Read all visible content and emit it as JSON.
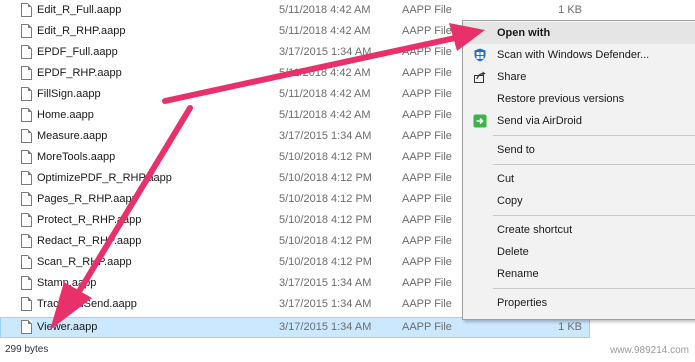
{
  "file_list": {
    "rows": [
      {
        "name": "Edit_R_Full.aapp",
        "date": "5/11/2018 4:42 AM",
        "type": "AAPP File",
        "size": "1 KB"
      },
      {
        "name": "Edit_R_RHP.aapp",
        "date": "5/11/2018 4:42 AM",
        "type": "AAPP File",
        "size": ""
      },
      {
        "name": "EPDF_Full.aapp",
        "date": "3/17/2015 1:34 AM",
        "type": "AAPP File",
        "size": ""
      },
      {
        "name": "EPDF_RHP.aapp",
        "date": "5/11/2018 4:42 AM",
        "type": "AAPP File",
        "size": ""
      },
      {
        "name": "FillSign.aapp",
        "date": "5/11/2018 4:42 AM",
        "type": "AAPP File",
        "size": ""
      },
      {
        "name": "Home.aapp",
        "date": "5/11/2018 4:42 AM",
        "type": "AAPP File",
        "size": ""
      },
      {
        "name": "Measure.aapp",
        "date": "3/17/2015 1:34 AM",
        "type": "AAPP File",
        "size": ""
      },
      {
        "name": "MoreTools.aapp",
        "date": "5/10/2018 4:12 PM",
        "type": "AAPP File",
        "size": ""
      },
      {
        "name": "OptimizePDF_R_RHP.aapp",
        "date": "5/10/2018 4:12 PM",
        "type": "AAPP File",
        "size": ""
      },
      {
        "name": "Pages_R_RHP.aapp",
        "date": "5/10/2018 4:12 PM",
        "type": "AAPP File",
        "size": ""
      },
      {
        "name": "Protect_R_RHP.aapp",
        "date": "5/10/2018 4:12 PM",
        "type": "AAPP File",
        "size": ""
      },
      {
        "name": "Redact_R_RHP.aapp",
        "date": "5/10/2018 4:12 PM",
        "type": "AAPP File",
        "size": ""
      },
      {
        "name": "Scan_R_RHP.aapp",
        "date": "5/10/2018 4:12 PM",
        "type": "AAPP File",
        "size": ""
      },
      {
        "name": "Stamp.aapp",
        "date": "3/17/2015 1:34 AM",
        "type": "AAPP File",
        "size": ""
      },
      {
        "name": "TrackAndSend.aapp",
        "date": "3/17/2015 1:34 AM",
        "type": "AAPP File",
        "size": ""
      },
      {
        "name": "Viewer.aapp",
        "date": "3/17/2015 1:34 AM",
        "type": "AAPP File",
        "size": "1 KB"
      }
    ]
  },
  "status_bar": {
    "selection_size": "299 bytes"
  },
  "watermark": "www.989214.com",
  "context_menu": {
    "open_with": {
      "label": "Open with",
      "icon": ""
    },
    "scan_defender": {
      "label": "Scan with Windows Defender...",
      "icon": "windows-defender-icon"
    },
    "share": {
      "label": "Share",
      "icon": "share-icon"
    },
    "restore_versions": {
      "label": "Restore previous versions",
      "icon": ""
    },
    "send_airdroid": {
      "label": "Send via AirDroid",
      "icon": "airdroid-icon"
    },
    "send_to": {
      "label": "Send to",
      "icon": ""
    },
    "cut": {
      "label": "Cut",
      "icon": ""
    },
    "copy": {
      "label": "Copy",
      "icon": ""
    },
    "create_shortcut": {
      "label": "Create shortcut",
      "icon": ""
    },
    "delete": {
      "label": "Delete",
      "icon": ""
    },
    "rename": {
      "label": "Rename",
      "icon": ""
    },
    "properties": {
      "label": "Properties",
      "icon": ""
    }
  },
  "colors": {
    "selection": "#cce8ff",
    "annotation_arrow": "#e8306a",
    "menu_background": "#f2f2f2",
    "airdroid_green": "#3bb54a",
    "defender_blue": "#1f6fc5"
  }
}
